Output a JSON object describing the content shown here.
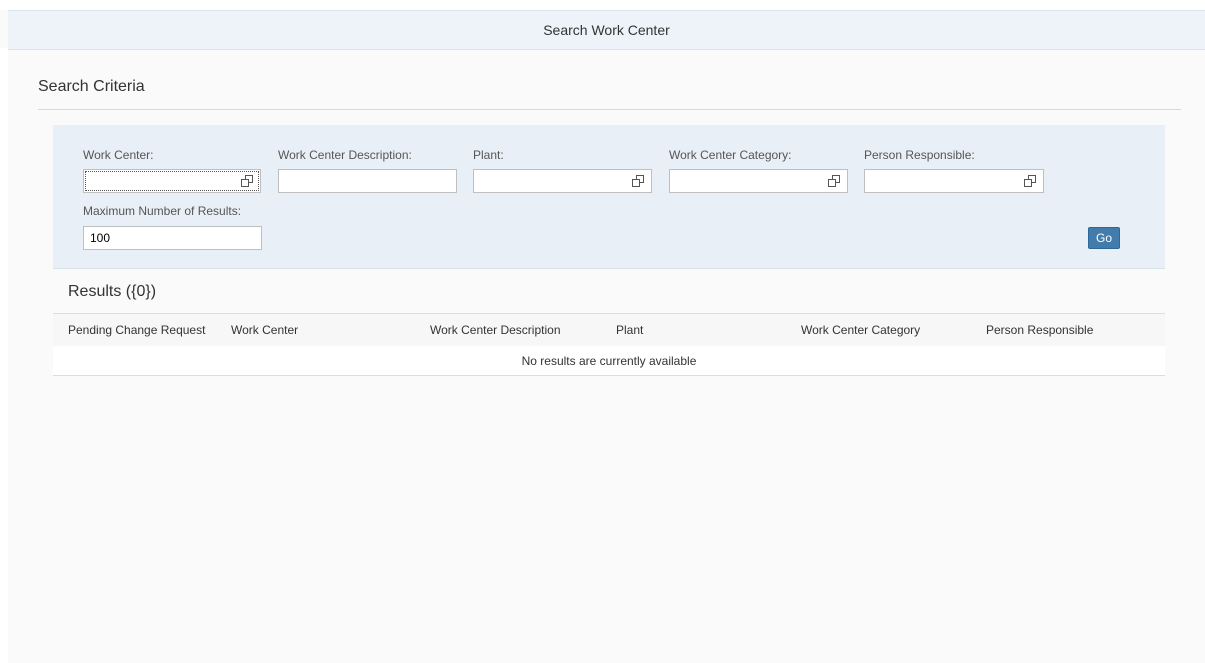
{
  "window": {
    "title": "Search Work Center"
  },
  "criteria": {
    "title": "Search Criteria",
    "fields": {
      "work_center": {
        "label": "Work Center:",
        "value": ""
      },
      "work_center_description": {
        "label": "Work Center Description:",
        "value": ""
      },
      "plant": {
        "label": "Plant:",
        "value": ""
      },
      "work_center_category": {
        "label": "Work Center Category:",
        "value": ""
      },
      "person_responsible": {
        "label": "Person Responsible:",
        "value": ""
      },
      "max_results": {
        "label": "Maximum Number of Results:",
        "value": "100"
      }
    },
    "go_label": "Go"
  },
  "results": {
    "title": "Results ({0})",
    "columns": [
      "Pending Change Request",
      "Work Center",
      "Work Center Description",
      "Plant",
      "Work Center Category",
      "Person Responsible"
    ],
    "empty_text": "No results are currently available"
  },
  "colors": {
    "accent": "#427cac",
    "title_bar_bg": "#edf3f8",
    "filter_panel_bg": "#e8eff6"
  },
  "icons": {
    "value_help": "value-help-icon"
  }
}
